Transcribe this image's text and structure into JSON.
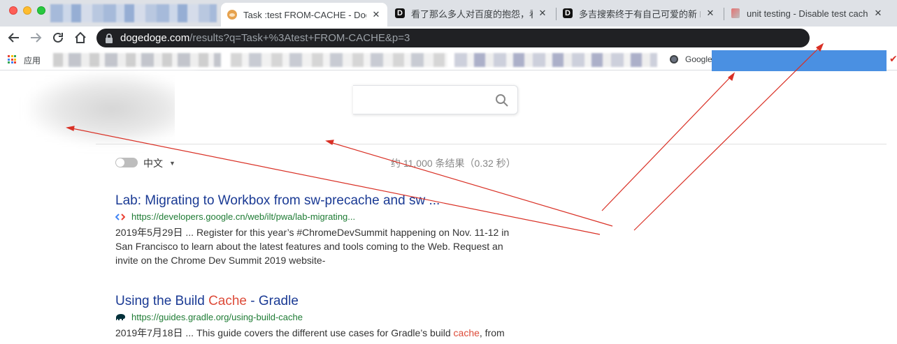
{
  "browser": {
    "tabs": [
      {
        "title": "Task :test FROM-CACHE - Dog",
        "active": true,
        "favicon": "doge-icon"
      },
      {
        "title": "看了那么多人对百度的抱怨，看",
        "active": false,
        "favicon": "dogedoge-d-icon"
      },
      {
        "title": "多吉搜索终于有自己可爱的新 LO",
        "active": false,
        "favicon": "dogedoge-d-icon"
      },
      {
        "title": "unit testing - Disable test cach",
        "active": false,
        "favicon": "stack-icon"
      }
    ],
    "close_glyph": "✕",
    "url_host": "dogedoge.com",
    "url_rest": "/results?q=Task+%3Atest+FROM-CACHE&p=3"
  },
  "bookmarks": {
    "apps_label": "应用",
    "google_label": "Google"
  },
  "search": {
    "language_label": "中文",
    "stats": "约 11,000 条结果（0.32 秒）"
  },
  "results": [
    {
      "title_parts": [
        "Lab: Migrating to Workbox from sw-precache and sw ..."
      ],
      "url": "https://developers.google.cn/web/ilt/pwa/lab-migrating...",
      "snippet": "2019年5月29日 ... Register for this year’s #ChromeDevSummit happening on Nov. 11-12 in San Francisco to learn about the latest features and tools coming to the Web. Request an invite on the Chrome Dev Summit 2019 website-"
    },
    {
      "title_before": "Using the Build ",
      "title_highlight": "Cache",
      "title_after": " - Gradle",
      "url": "https://guides.gradle.org/using-build-cache",
      "snippet_before": "2019年7月18日 ... This guide covers the different use cases for Gradle’s build ",
      "snippet_highlight": "cache",
      "snippet_after": ", from"
    }
  ],
  "colors": {
    "link_title": "#1a3a94",
    "url_green": "#1e7b34",
    "highlight": "#dd4b39",
    "annotation_red": "#d93025",
    "omnibox": "#202124"
  }
}
